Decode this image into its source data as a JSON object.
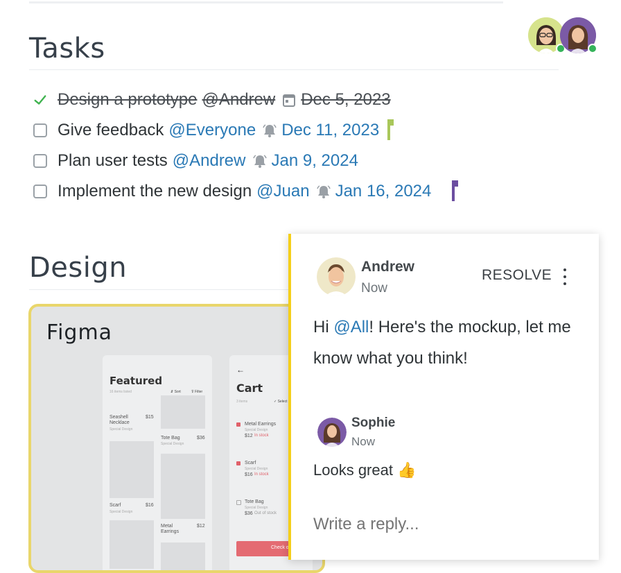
{
  "presence": {
    "users": [
      {
        "name": "user-1",
        "ring_color": "#d6e38c"
      },
      {
        "name": "user-2",
        "ring_color": "#7b5aa6"
      }
    ]
  },
  "sections": {
    "tasks_title": "Tasks",
    "design_title": "Design"
  },
  "tasks": [
    {
      "title": "Design a prototype",
      "assignee": "@Andrew",
      "date": "Dec 5, 2023",
      "done": true,
      "icon": "calendar-icon"
    },
    {
      "title": "Give feedback",
      "assignee": "@Everyone",
      "date": "Dec 11, 2023",
      "done": false,
      "icon": "bell-icon",
      "flag_color": "#a9c75a"
    },
    {
      "title": "Plan user tests",
      "assignee": "@Andrew",
      "date": "Jan 9, 2024",
      "done": false,
      "icon": "bell-icon"
    },
    {
      "title": "Implement the new design",
      "assignee": "@Juan",
      "date": "Jan 16, 2024",
      "done": false,
      "icon": "bell-icon",
      "flag_color": "#6c4ea0"
    }
  ],
  "figma": {
    "label": "Figma",
    "featured": {
      "title": "Featured",
      "subtitle": "16 items listed",
      "sort": "⇵ Sort",
      "filter": "⊽ Filter",
      "items": [
        {
          "name": "Seashell Necklace",
          "price": "$15",
          "sub": "Special Design"
        },
        {
          "name": "Tote Bag",
          "price": "$36",
          "sub": "Special Design"
        },
        {
          "name": "Scarf",
          "price": "$16",
          "sub": "Special Design"
        },
        {
          "name": "Metal Earrings",
          "price": "$12",
          "sub": "Special Design"
        }
      ]
    },
    "cart": {
      "back": "←",
      "title": "Cart",
      "count": "3 items",
      "select": "✓ Select",
      "items": [
        {
          "name": "Metal Earrings",
          "sub": "Special Design",
          "price": "$12",
          "stock": "In stock"
        },
        {
          "name": "Scarf",
          "sub": "Special Design",
          "price": "$16",
          "stock": "In stock"
        },
        {
          "name": "Tote Bag",
          "sub": "Special Design",
          "price": "$36",
          "stock": "Out of stock"
        }
      ],
      "checkout": "Check o"
    }
  },
  "comment": {
    "author": "Andrew",
    "time": "Now",
    "resolve_label": "RESOLVE",
    "body_prefix": "Hi ",
    "body_mention": "@All",
    "body_suffix": "! Here's the mockup, let me know what you think!",
    "reply": {
      "author": "Sophie",
      "time": "Now",
      "text": "Looks great 👍"
    },
    "reply_placeholder": "Write a reply..."
  },
  "colors": {
    "accent_blue": "#2a79b5",
    "comment_bar": "#f5cf1a",
    "figma_border": "#e9d66b",
    "check_green": "#3fb34f"
  }
}
